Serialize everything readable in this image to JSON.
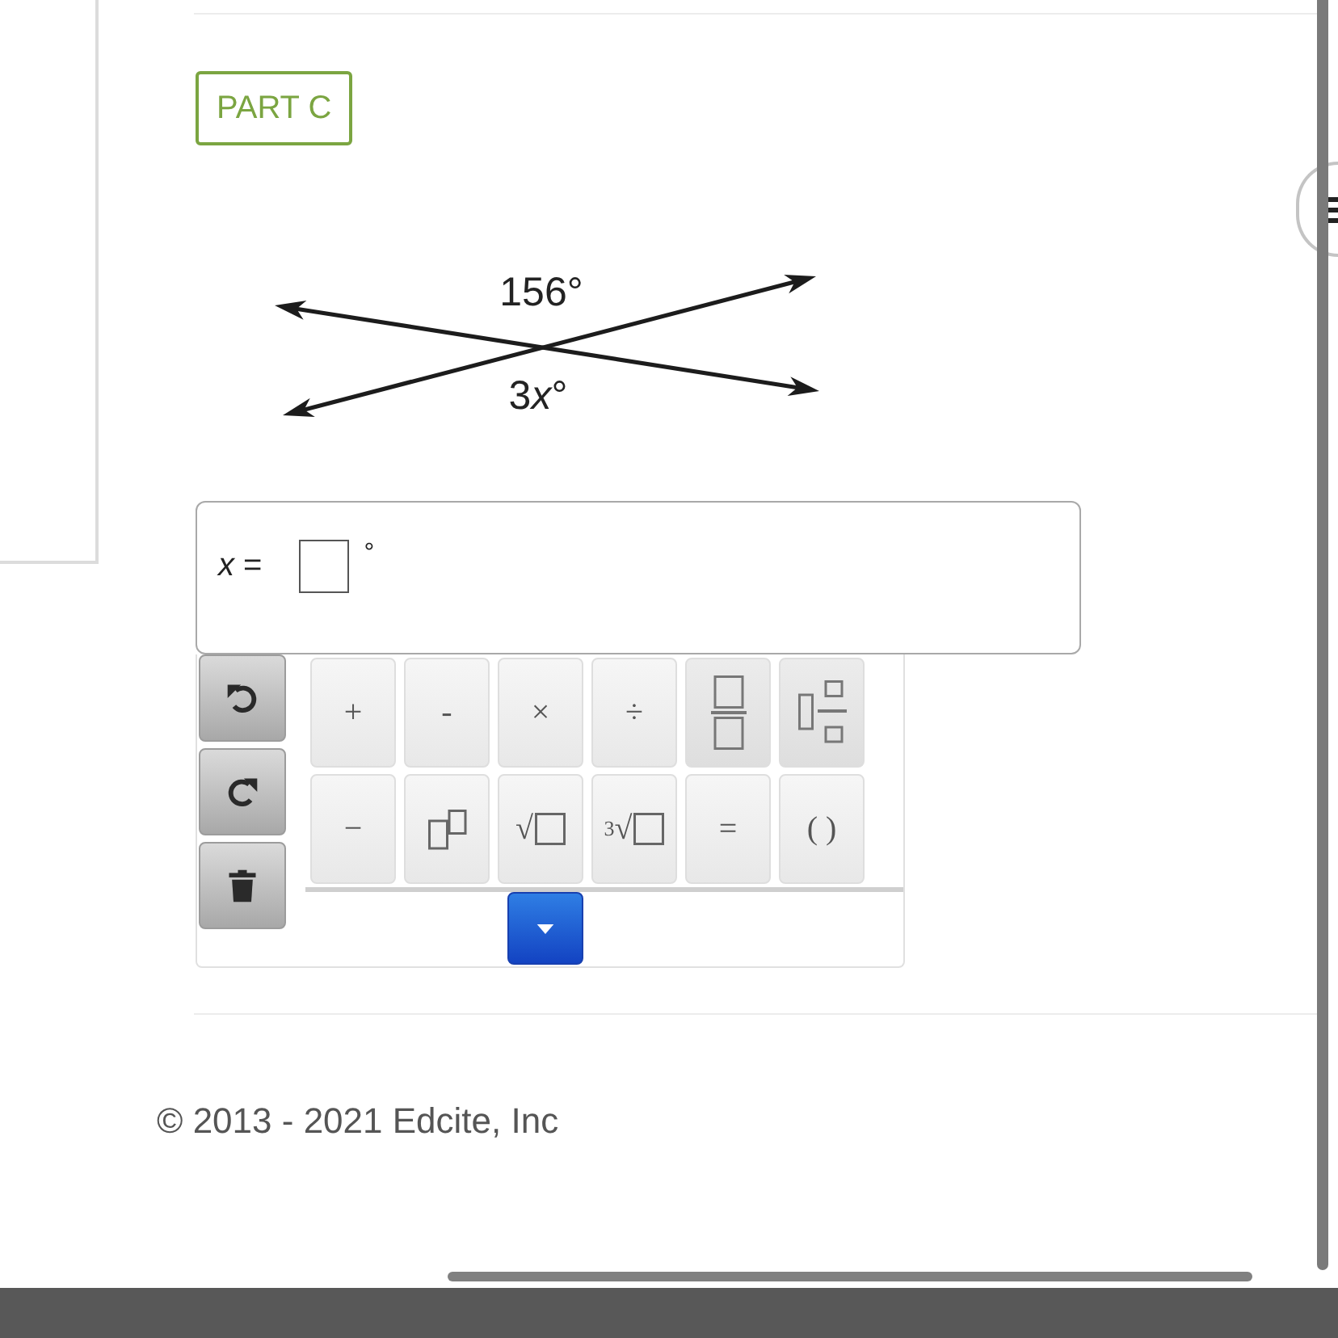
{
  "badge": "PART C",
  "figure": {
    "labels": [
      {
        "runs": [
          {
            "text": "156°",
            "italic": false
          }
        ]
      },
      {
        "runs": [
          {
            "text": "3",
            "italic": false
          },
          {
            "text": "x",
            "italic": true
          },
          {
            "text": "°",
            "italic": false
          }
        ]
      }
    ]
  },
  "answer": {
    "label": "*x* =",
    "unit": "°"
  },
  "keypad": {
    "rows": [
      [
        {
          "kind": "text",
          "label": "+"
        },
        {
          "kind": "text",
          "label": "-"
        },
        {
          "kind": "text",
          "label": "×"
        },
        {
          "kind": "text",
          "label": "÷"
        },
        {
          "kind": "fraction"
        },
        {
          "kind": "mixed_fraction"
        }
      ],
      [
        {
          "kind": "text",
          "label": "−"
        },
        {
          "kind": "power"
        },
        {
          "kind": "root",
          "label": "√"
        },
        {
          "kind": "root",
          "label": "$^{3}$√"
        },
        {
          "kind": "text",
          "label": "="
        },
        {
          "kind": "text",
          "label": "( )"
        }
      ]
    ]
  },
  "footer": {
    "copyright": "© 2013 - 2021 Edcite, Inc"
  }
}
